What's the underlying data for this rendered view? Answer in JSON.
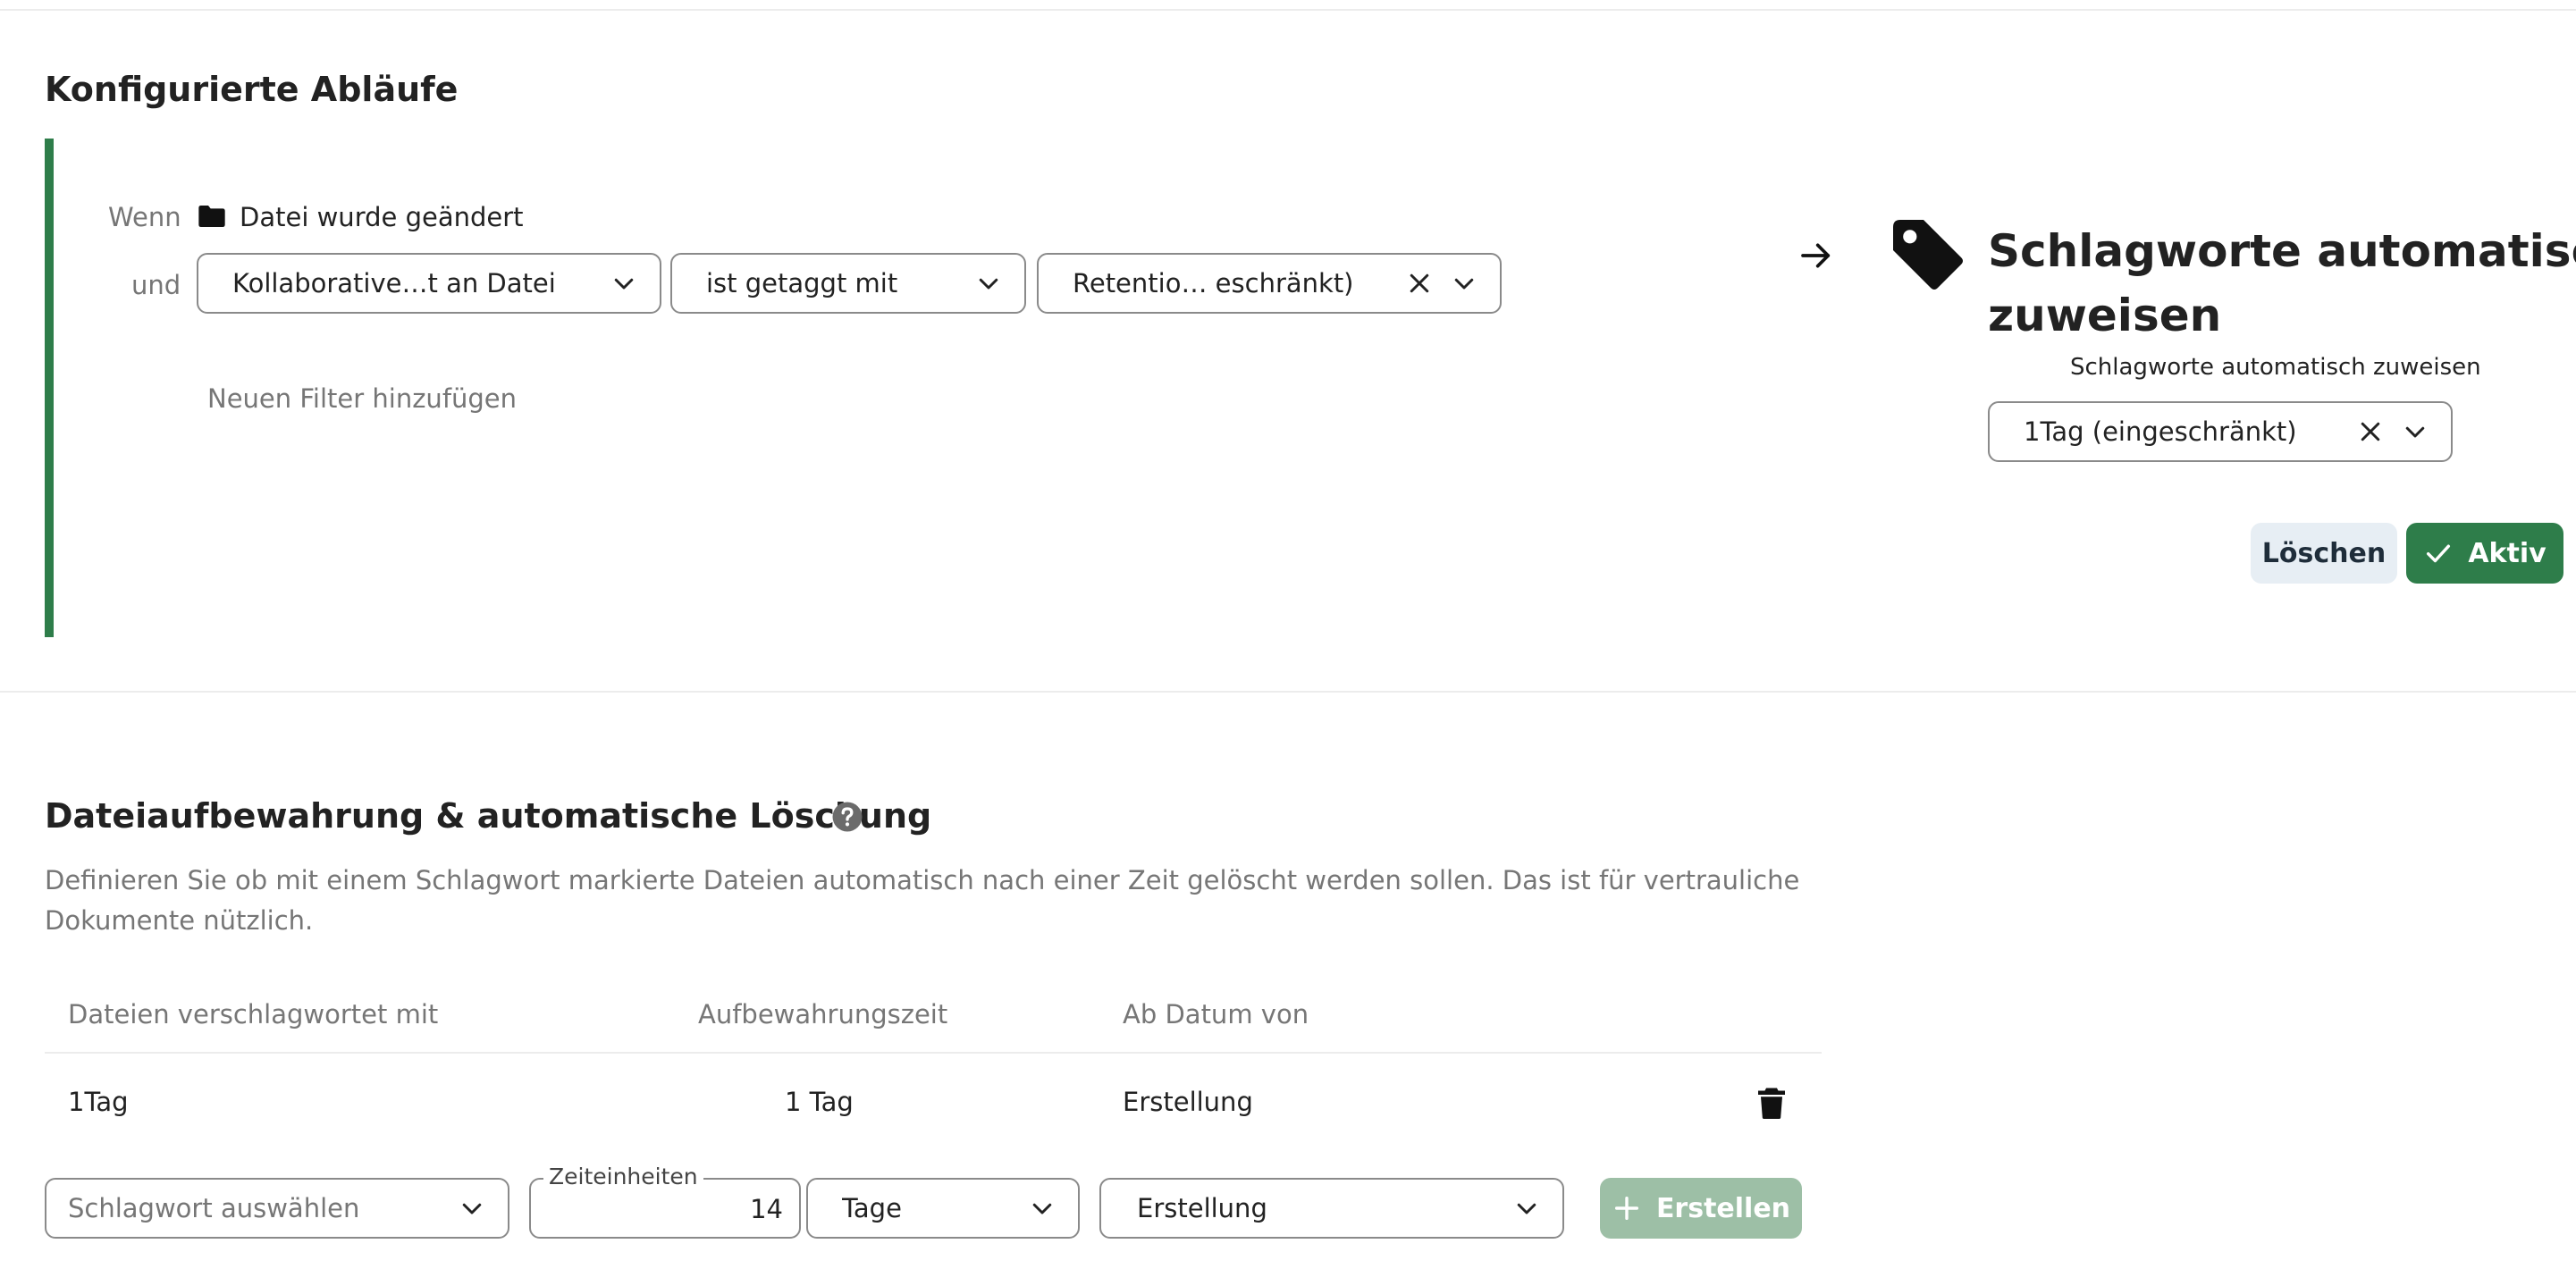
{
  "flows": {
    "title": "Konfigurierte Abläufe",
    "when_label": "Wenn",
    "trigger": "Datei wurde geändert",
    "and_label": "und",
    "filter": {
      "attribute": "Kollaborative…t an Datei",
      "operator": "ist getaggt mit",
      "value": "Retentio… eschränkt)"
    },
    "add_filter": "Neuen Filter hinzufügen",
    "action": {
      "title_line1": "Schlagworte automatisch",
      "title_line2": "zuweisen",
      "subtitle": "Schlagworte automatisch zuweisen",
      "tag_value": "1Tag (eingeschränkt)"
    },
    "delete_label": "Löschen",
    "active_label": "Aktiv"
  },
  "retention": {
    "title": "Dateiaufbewahrung & automatische Löschung",
    "description_line1": "Definieren Sie ob mit einem Schlagwort markierte Dateien automatisch nach einer Zeit gelöscht werden sollen. Das ist für vertrauliche",
    "description_line2": "Dokumente nützlich.",
    "columns": [
      "Dateien verschlagwortet mit",
      "Aufbewahrungszeit",
      "Ab Datum von"
    ],
    "rows": [
      {
        "tag": "1Tag",
        "time": "1 Tag",
        "from": "Erstellung"
      }
    ],
    "form": {
      "tag_placeholder": "Schlagwort auswählen",
      "units_legend": "Zeiteinheiten",
      "units_value": "14",
      "unit": "Tage",
      "from": "Erstellung",
      "create_label": "Erstellen"
    }
  },
  "colors": {
    "accent": "#2e7d4a",
    "accent_disabled": "#9dbfa6",
    "secondary_button": "#e7eef4"
  }
}
